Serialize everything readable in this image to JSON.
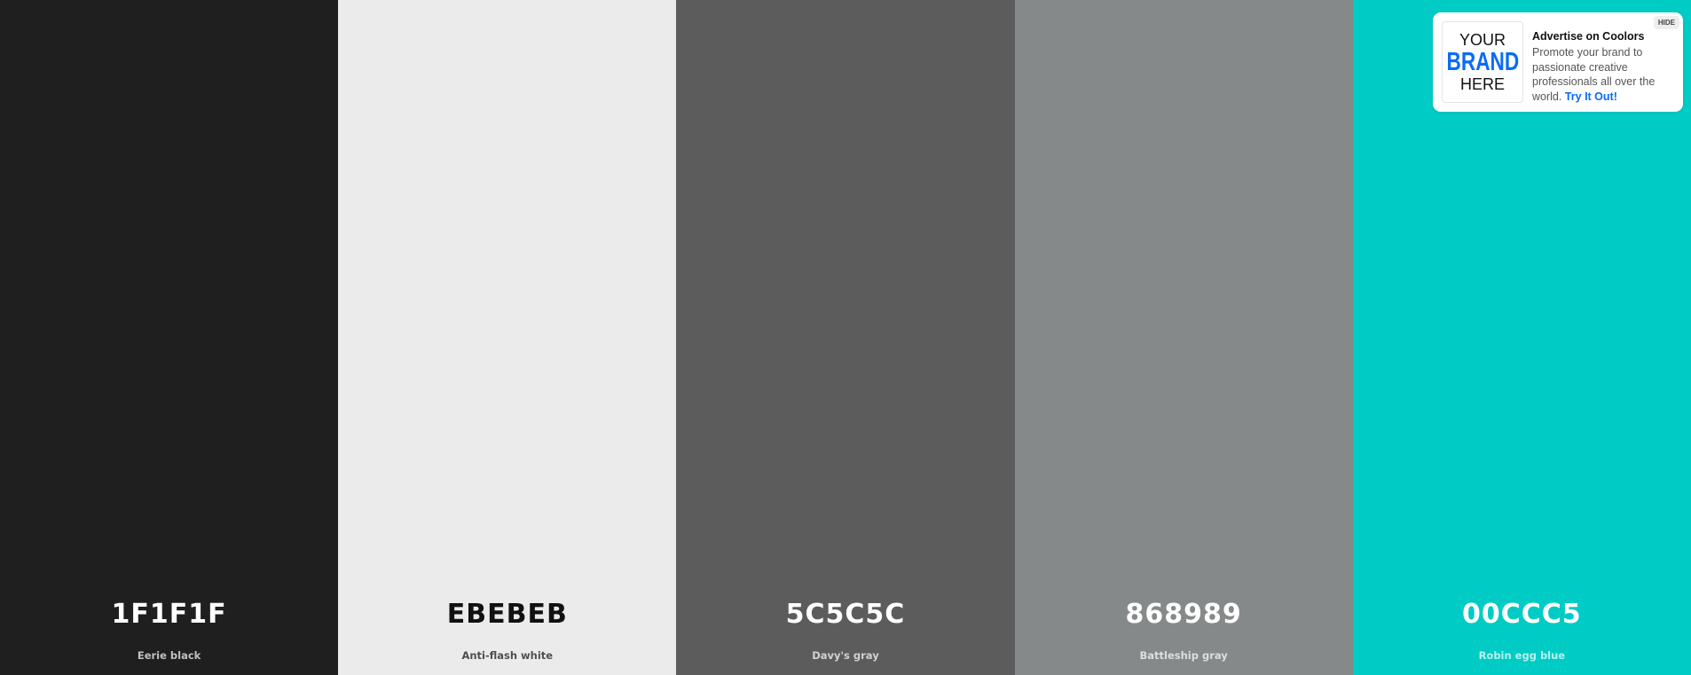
{
  "palette": {
    "colors": [
      {
        "hex": "1F1F1F",
        "name": "Eerie black",
        "color": "#1f1f1f",
        "text_tone": "light"
      },
      {
        "hex": "EBEBEB",
        "name": "Anti-flash white",
        "color": "#ebebeb",
        "text_tone": "dark"
      },
      {
        "hex": "5C5C5C",
        "name": "Davy's gray",
        "color": "#5c5c5c",
        "text_tone": "light"
      },
      {
        "hex": "868989",
        "name": "Battleship gray",
        "color": "#868989",
        "text_tone": "light"
      },
      {
        "hex": "00CCC5",
        "name": "Robin egg blue",
        "color": "#00ccc5",
        "text_tone": "light"
      }
    ]
  },
  "ad": {
    "logo_line1": "YOUR",
    "logo_line2": "BRAND",
    "logo_line3": "HERE",
    "title": "Advertise on Coolors",
    "body": "Promote your brand to passionate creative professionals all over the world.",
    "cta": "Try It Out!",
    "hide_label": "HIDE",
    "cta_color": "#0a6cf5"
  }
}
